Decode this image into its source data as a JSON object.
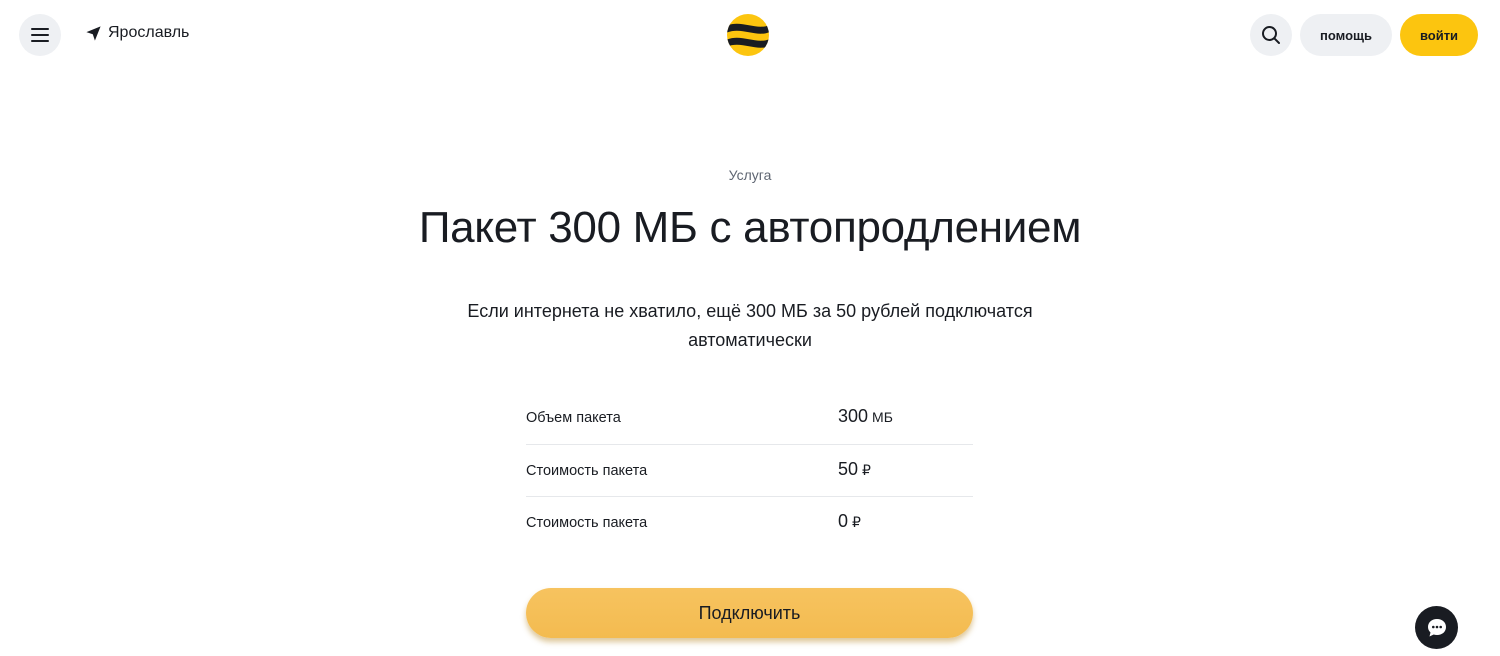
{
  "header": {
    "city": "Ярославль",
    "help_label": "помощь",
    "login_label": "войти",
    "brand_color": "#fcc50f",
    "icons": [
      "menu-icon",
      "location-arrow-icon",
      "beeline-logo",
      "search-icon"
    ]
  },
  "main": {
    "kicker": "Услуга",
    "title": "Пакет 300 МБ с автопродлением",
    "description": "Если интернета не хватило, ещё 300 МБ за 50 рублей подключатся автоматически",
    "params": [
      {
        "label": "Объем пакета",
        "value": "300",
        "unit": "МБ"
      },
      {
        "label": "Стоимость пакета",
        "value": "50",
        "unit": "₽"
      },
      {
        "label": "Стоимость пакета",
        "value": "0",
        "unit": "₽"
      }
    ],
    "connect_label": "Подключить"
  },
  "chat": {
    "icon": "chat-bubble-icon"
  }
}
